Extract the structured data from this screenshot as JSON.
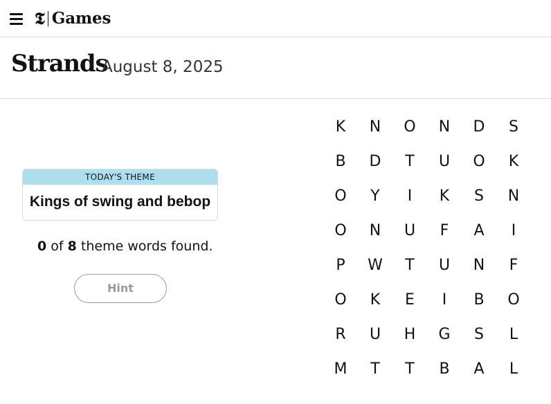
{
  "header": {
    "menu_icon": "hamburger-menu-icon",
    "logo_mark": "𝕿",
    "brand_name": "Games"
  },
  "title_bar": {
    "title": "Strands",
    "date": "August 8, 2025"
  },
  "theme": {
    "label": "TODAY'S THEME",
    "value": "Kings of swing and bebop",
    "header_color": "#aedfee"
  },
  "progress": {
    "found": "0",
    "of_text": "of",
    "total": "8",
    "suffix": "theme words found."
  },
  "hint_button": {
    "label": "Hint"
  },
  "board": {
    "rows": [
      [
        "K",
        "N",
        "O",
        "N",
        "D",
        "S"
      ],
      [
        "B",
        "D",
        "T",
        "U",
        "O",
        "K"
      ],
      [
        "O",
        "Y",
        "I",
        "K",
        "S",
        "N"
      ],
      [
        "O",
        "N",
        "U",
        "F",
        "A",
        "I"
      ],
      [
        "P",
        "W",
        "T",
        "U",
        "N",
        "F"
      ],
      [
        "O",
        "K",
        "E",
        "I",
        "B",
        "O"
      ],
      [
        "R",
        "U",
        "H",
        "G",
        "S",
        "L"
      ],
      [
        "M",
        "T",
        "T",
        "B",
        "A",
        "L"
      ]
    ]
  }
}
